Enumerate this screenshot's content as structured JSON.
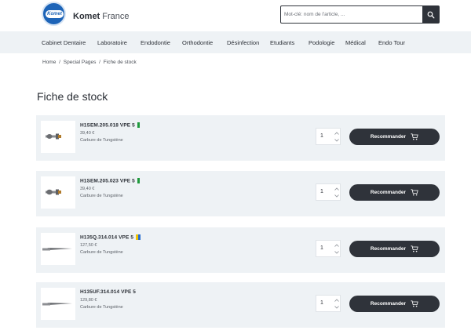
{
  "brand": {
    "logo_text": "Komet",
    "name_bold": "Komet",
    "name_light": "France"
  },
  "search": {
    "placeholder": "Mot-clé: nom de l'article, ..."
  },
  "nav": {
    "items": [
      {
        "label": "Cabinet Dentaire"
      },
      {
        "label": "Laboratoire"
      },
      {
        "label": "Endodontie"
      },
      {
        "label": "Orthodontie"
      },
      {
        "label": "Désinfection"
      },
      {
        "label": "Etudiants"
      },
      {
        "label": "Podologie"
      },
      {
        "label": "Médical"
      },
      {
        "label": "Endo Tour"
      }
    ]
  },
  "breadcrumb": {
    "home": "Home",
    "special": "Special Pages",
    "current": "Fiche de stock",
    "separator": "/"
  },
  "page": {
    "title": "Fiche de stock"
  },
  "colors": {
    "accent_dark": "#2f333a",
    "row_bg": "#eef2f5",
    "logo_blue": "#1d64b8",
    "flag_green": "#1e9a3c",
    "flag_yellow": "#f2c400",
    "flag_blue": "#2a6fd1"
  },
  "products": [
    {
      "name": "H1SEM.205.018 VPE 5",
      "price": "39,40 €",
      "material": "Carbure de Tungstène",
      "quantity": "1",
      "button_label": "Recommander",
      "icon": "bur-round-icon",
      "flags": [
        "green"
      ]
    },
    {
      "name": "H1SEM.205.023 VPE 5",
      "price": "39,40 €",
      "material": "Carbure de Tungstène",
      "quantity": "1",
      "button_label": "Recommander",
      "icon": "bur-round-icon",
      "flags": [
        "green"
      ]
    },
    {
      "name": "H135Q.314.014 VPE 5",
      "price": "127,50 €",
      "material": "Carbure de Tungstène",
      "quantity": "1",
      "button_label": "Recommander",
      "icon": "bur-needle-icon",
      "flags": [
        "yellow",
        "blue"
      ]
    },
    {
      "name": "H135UF.314.014 VPE 5",
      "price": "129,80 €",
      "material": "Carbure de Tungstène",
      "quantity": "1",
      "button_label": "Recommander",
      "icon": "bur-needle-icon",
      "flags": []
    }
  ]
}
